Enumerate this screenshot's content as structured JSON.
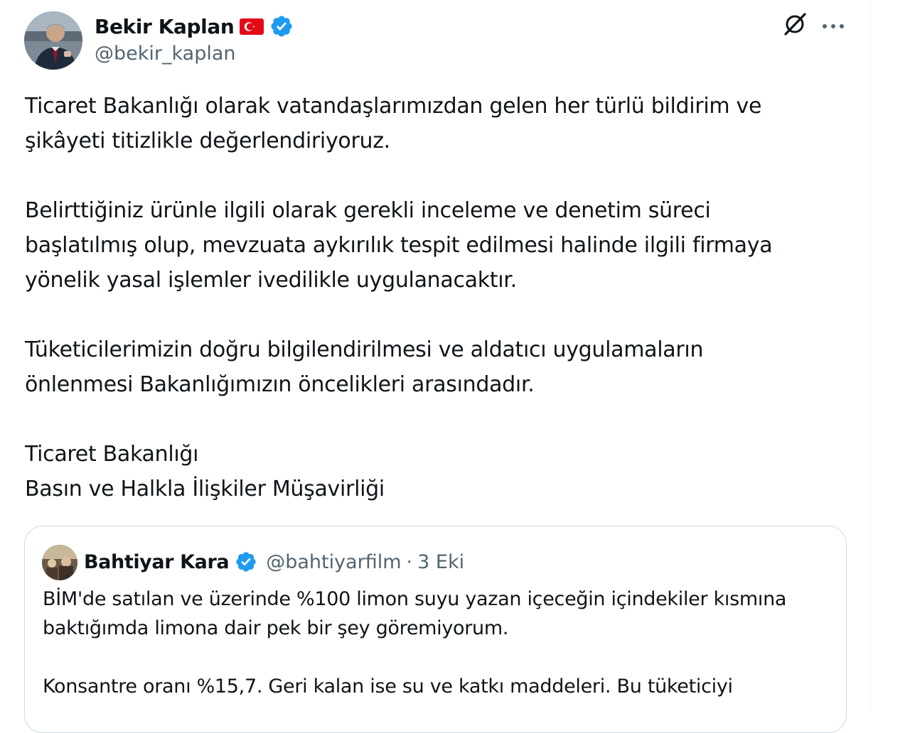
{
  "tweet": {
    "author": {
      "display_name": "Bekir Kaplan",
      "handle": "@bekir_kaplan",
      "flag_icon": "turkey-flag-emoji",
      "verified_icon": "verified-badge",
      "verified_color": "#1d9bf0"
    },
    "actions": {
      "grok_icon": "grok-icon",
      "more_icon": "more-horizontal-icon"
    },
    "text": "Ticaret Bakanlığı olarak vatandaşlarımızdan gelen her türlü bildirim ve\nşikâyeti titizlikle değerlendiriyoruz.\n\nBelirttiğiniz ürünle ilgili olarak gerekli inceleme ve denetim süreci\nbaşlatılmış olup, mevzuata aykırılık tespit edilmesi halinde ilgili firmaya\nyönelik yasal işlemler ivedilikle uygulanacaktır.\n\nTüketicilerimizin doğru bilgilendirilmesi ve aldatıcı uygulamaların\nönlenmesi Bakanlığımızın öncelikleri arasındadır.\n\nTicaret Bakanlığı\nBasın ve Halkla İlişkiler Müşavirliği"
  },
  "quoted_tweet": {
    "author": {
      "display_name": "Bahtiyar Kara",
      "handle": "@bahtiyarfilm",
      "verified_icon": "verified-badge"
    },
    "separator": "·",
    "date": "3 Eki",
    "text": "BİM'de satılan ve üzerinde %100 limon suyu yazan içeceğin içindekiler kısmına\nbaktığımda limona dair pek bir şey göremiyorum.\n\nKonsantre oranı %15,7. Geri kalan ise su ve katkı maddeleri. Bu tüketiciyi"
  },
  "colors": {
    "text_primary": "#0f1419",
    "text_secondary": "#536471",
    "border": "#cfd9de",
    "verified": "#1d9bf0",
    "flag_red": "#e30a17"
  }
}
